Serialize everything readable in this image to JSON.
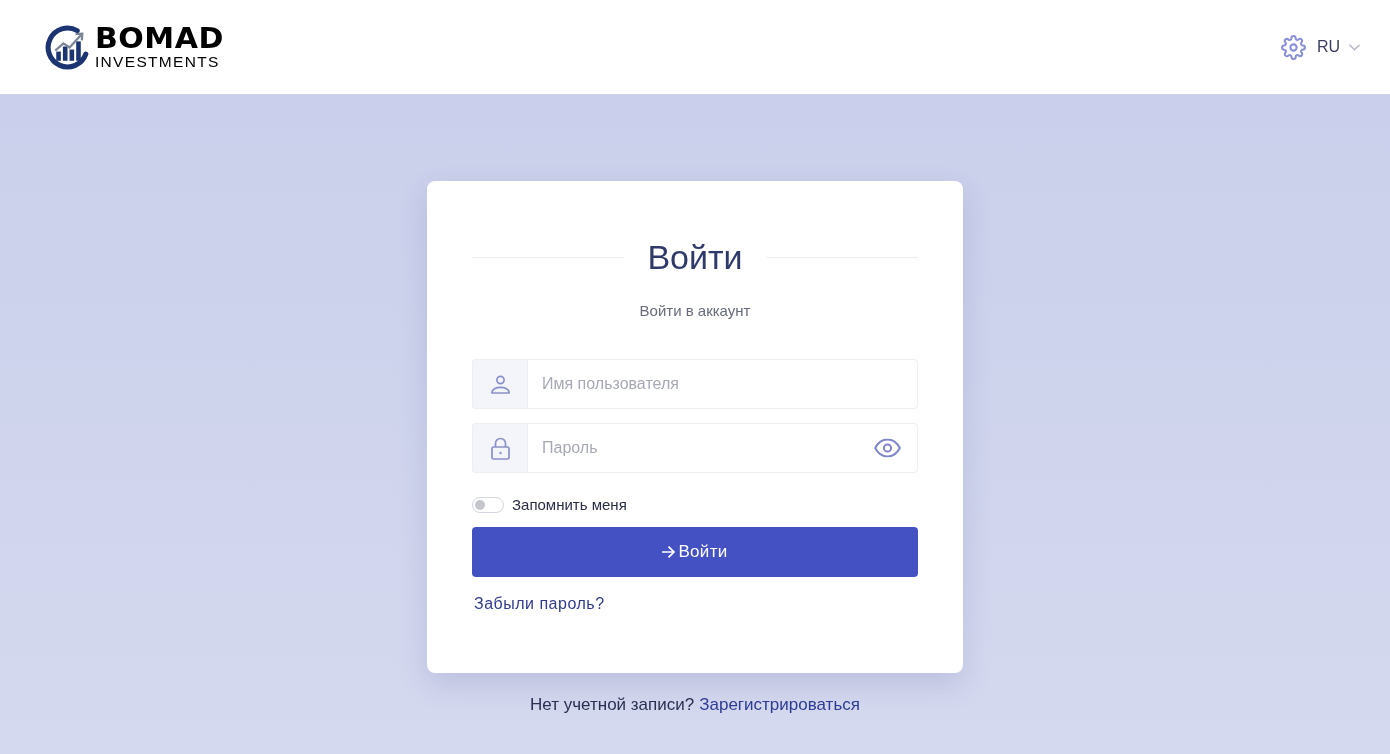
{
  "header": {
    "logo": {
      "title": "BOMAD",
      "subtitle": "INVESTMENTS"
    },
    "language": {
      "label": "RU"
    }
  },
  "login_card": {
    "title": "Войти",
    "subtitle": "Войти в аккаунт",
    "fields": [
      {
        "kind": "text",
        "placeholder": "Имя пользователя"
      },
      {
        "kind": "password",
        "placeholder": "Пароль"
      }
    ],
    "remember_me": {
      "label": "Запомнить меня",
      "on": false
    },
    "submit_button": {
      "label": "Войти"
    },
    "forgot_link": "Забыли пароль?"
  },
  "footer": {
    "text": "Нет учетной записи?",
    "link": "Зарегистрироваться"
  }
}
